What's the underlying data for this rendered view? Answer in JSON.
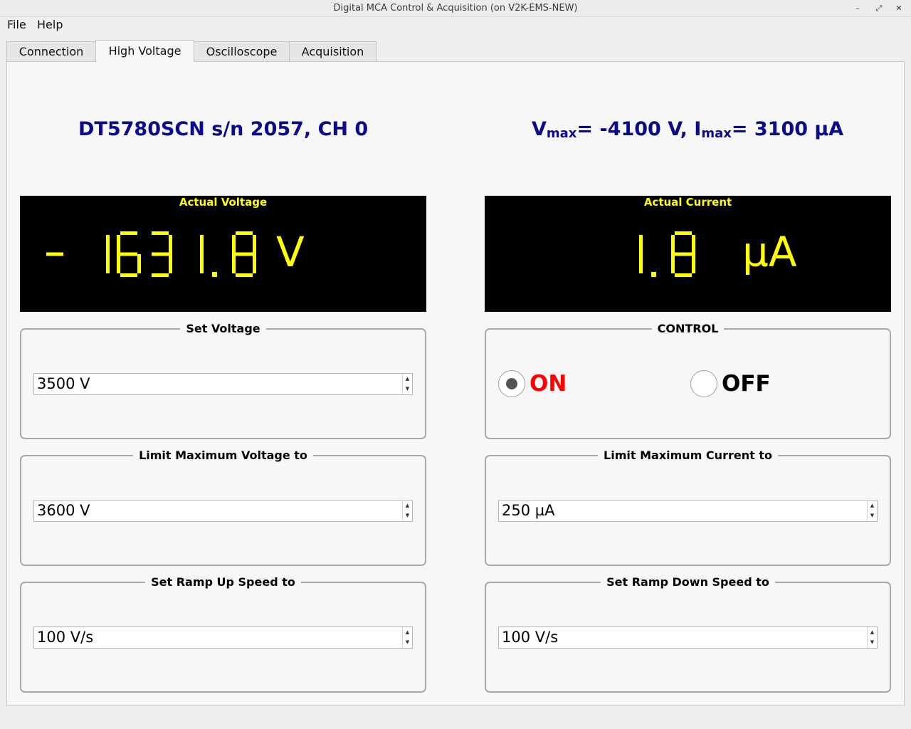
{
  "window": {
    "title": "Digital MCA Control & Acquisition (on V2K-EMS-NEW)"
  },
  "menu": {
    "file": "File",
    "help": "Help"
  },
  "tabs": [
    {
      "label": "Connection"
    },
    {
      "label": "High Voltage",
      "active": true
    },
    {
      "label": "Oscilloscope"
    },
    {
      "label": "Acquisition"
    }
  ],
  "device": {
    "label": "DT5780SCN s/n 2057, CH 0"
  },
  "limits": {
    "v_prefix": "V",
    "v_sub": "max",
    "v_text": "= -4100 V, ",
    "i_prefix": "I",
    "i_sub": "max",
    "i_text": "= 3100 µA"
  },
  "voltage_display": {
    "label": "Actual Voltage",
    "value": "-1631.8",
    "unit": "V"
  },
  "current_display": {
    "label": "Actual Current",
    "value": "1.8",
    "unit": "µA"
  },
  "set_voltage": {
    "title": "Set Voltage",
    "value": "3500 V"
  },
  "control": {
    "title": "CONTROL",
    "on_label": "ON",
    "off_label": "OFF",
    "selected": "ON"
  },
  "limit_voltage": {
    "title": "Limit Maximum Voltage to",
    "value": "3600 V"
  },
  "limit_current": {
    "title": "Limit Maximum Current to",
    "value": "250 µA"
  },
  "ramp_up": {
    "title": "Set Ramp Up Speed to",
    "value": "100 V/s"
  },
  "ramp_down": {
    "title": "Set Ramp Down Speed to",
    "value": "100 V/s"
  },
  "colors": {
    "heading": "#0a0a8c",
    "display_bg": "#000000",
    "display_fg": "#ffff00",
    "on": "#ff0000"
  },
  "icons": {
    "minimize": "minimize-icon",
    "restore": "restore-icon",
    "close": "close-icon",
    "spin_up": "spin-up-arrow-icon",
    "spin_down": "spin-down-arrow-icon"
  }
}
